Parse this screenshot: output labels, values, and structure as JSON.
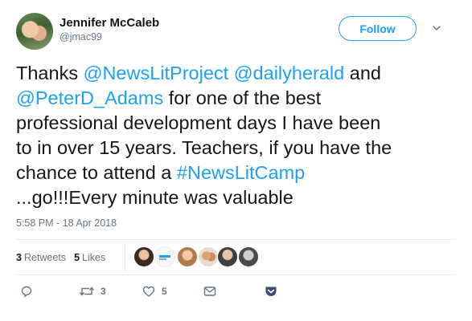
{
  "user": {
    "name": "Jennifer McCaleb",
    "handle": "@jmac99"
  },
  "follow_label": "Follow",
  "tweet": {
    "segments": [
      {
        "text": "Thanks ",
        "type": "text"
      },
      {
        "text": "@NewsLitProject",
        "type": "mention"
      },
      {
        "text": " ",
        "type": "text"
      },
      {
        "text": "@dailyherald",
        "type": "mention"
      },
      {
        "text": " and",
        "type": "text"
      },
      {
        "text": "@PeterD_Adams",
        "type": "mention"
      },
      {
        "text": " for one of the best",
        "type": "text"
      },
      {
        "text": "professional development days I have been",
        "type": "text"
      },
      {
        "text": "to in over 15 years. Teachers, if you have the",
        "type": "text"
      },
      {
        "text": "chance to attend a ",
        "type": "text"
      },
      {
        "text": "#NewsLitCamp",
        "type": "hashtag"
      },
      {
        "text": "...go!!!Every minute was valuable",
        "type": "text"
      }
    ]
  },
  "timestamp": "5:58 PM - 18 Apr 2018",
  "stats": {
    "retweets_count": "3",
    "retweets_label": "Retweets",
    "likes_count": "5",
    "likes_label": "Likes"
  },
  "actions": {
    "reply_count": "",
    "retweet_count": "3",
    "like_count": "5"
  },
  "icons": [
    "reply-icon",
    "retweet-icon",
    "heart-icon",
    "envelope-icon",
    "pocket-icon",
    "chevron-down-icon"
  ],
  "colors": {
    "link": "#1da1f2",
    "muted": "#657786",
    "text": "#14171a",
    "pocket": "#3d4b78"
  }
}
